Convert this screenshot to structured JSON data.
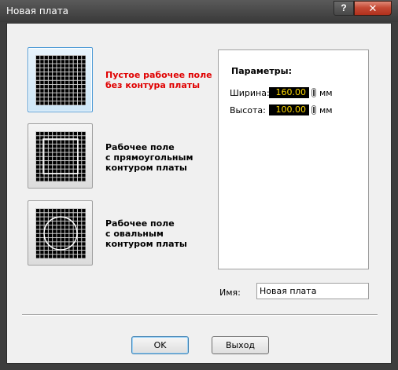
{
  "window": {
    "title": "Новая плата",
    "help_glyph": "?",
    "close_glyph": "✕"
  },
  "options": [
    {
      "lines": [
        "Пустое рабочее поле",
        "без контура платы"
      ],
      "selected": true,
      "outline": "none"
    },
    {
      "lines": [
        "Рабочее поле",
        "с прямоугольным",
        "контуром платы"
      ],
      "selected": false,
      "outline": "rect"
    },
    {
      "lines": [
        "Рабочее поле",
        "с овальным",
        "контуром платы"
      ],
      "selected": false,
      "outline": "oval"
    }
  ],
  "params": {
    "title": "Параметры:",
    "width_label": "Ширина:",
    "width_value": "160.00",
    "width_unit": "мм",
    "height_label": "Высота:",
    "height_value": "100.00",
    "height_unit": "мм"
  },
  "name": {
    "label": "Имя:",
    "value": "Новая плата"
  },
  "buttons": {
    "ok": "OK",
    "exit": "Выход"
  },
  "colors": {
    "selected_label": "#e00000",
    "field_bg": "#000000",
    "field_text": "#ffd800"
  }
}
